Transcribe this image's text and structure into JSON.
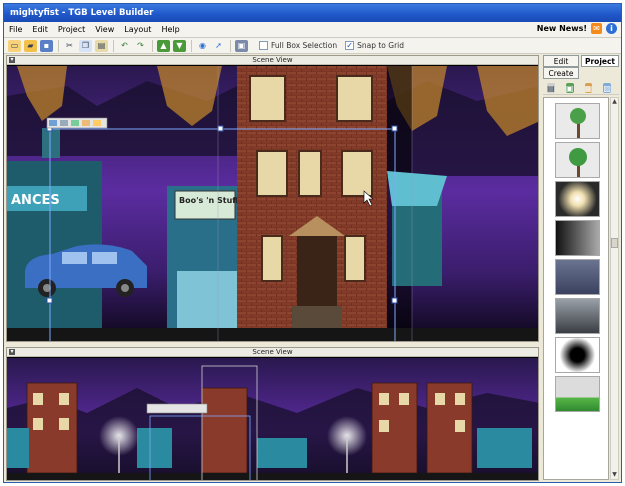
{
  "window": {
    "title": "mightyfist - TGB Level Builder"
  },
  "menu": {
    "items": [
      "File",
      "Edit",
      "Project",
      "View",
      "Layout",
      "Help"
    ]
  },
  "news": {
    "label": "New News!"
  },
  "toolbar": {
    "buttons": [
      "new-icon",
      "open-icon",
      "save-icon",
      "cut-icon",
      "copy-icon",
      "paste-icon",
      "undo-icon",
      "redo-icon",
      "import-icon",
      "export-icon",
      "play-icon",
      "select-icon",
      "camera-icon"
    ],
    "full_box_selection": {
      "label": "Full Box Selection",
      "checked": false
    },
    "snap_to_grid": {
      "label": "Snap to Grid",
      "checked": true
    }
  },
  "scenes": [
    {
      "title": "Scene View"
    },
    {
      "title": "Scene View"
    }
  ],
  "panel": {
    "tabs": {
      "edit": "Edit",
      "project": "Project",
      "create": "Create"
    },
    "assets": [
      "tree",
      "tree",
      "glow",
      "gradient",
      "cloud",
      "mist",
      "black-circle",
      "grass"
    ]
  },
  "colors": {
    "accent": "#1f56c8",
    "sky": "#3a1d6b",
    "brick": "#8a3a2a"
  },
  "scene_text": {
    "shop_sign": "Boo's 'n Stuff",
    "store_sign": "ANCES"
  }
}
